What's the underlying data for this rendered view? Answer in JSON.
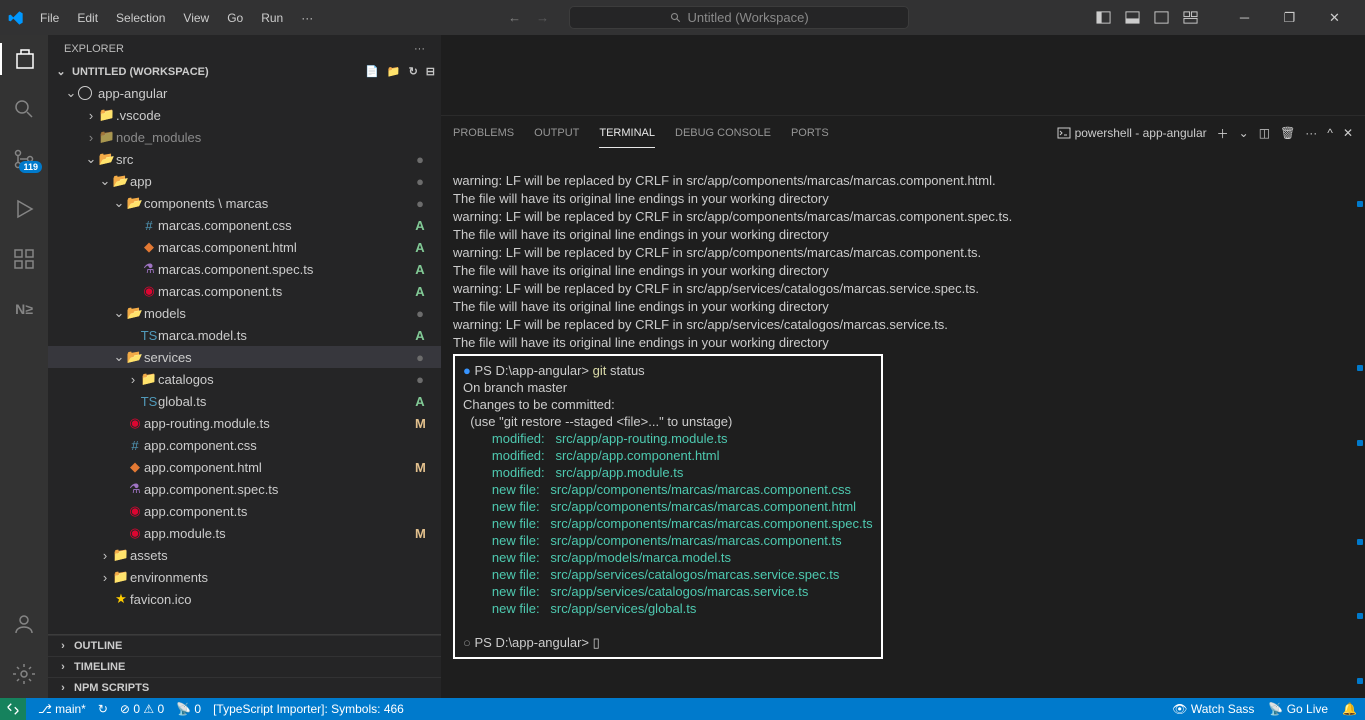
{
  "menu": [
    "File",
    "Edit",
    "Selection",
    "View",
    "Go",
    "Run"
  ],
  "searchBox": "Untitled (Workspace)",
  "scmBadge": "119",
  "explorer": {
    "title": "EXPLORER"
  },
  "workspace": "UNTITLED (WORKSPACE)",
  "rootFolder": "app-angular",
  "tree": {
    "vscode": ".vscode",
    "node_modules": "node_modules",
    "src": "src",
    "app": "app",
    "components": "components \\ marcas",
    "f_css": "marcas.component.css",
    "f_html": "marcas.component.html",
    "f_spec": "marcas.component.spec.ts",
    "f_ts": "marcas.component.ts",
    "models": "models",
    "model_ts": "marca.model.ts",
    "services": "services",
    "catalogos": "catalogos",
    "global": "global.ts",
    "routing": "app-routing.module.ts",
    "appcss": "app.component.css",
    "apphtml": "app.component.html",
    "appspec": "app.component.spec.ts",
    "appts": "app.component.ts",
    "appmodule": "app.module.ts",
    "assets": "assets",
    "env": "environments",
    "favicon": "favicon.ico"
  },
  "outline": "OUTLINE",
  "timeline": "TIMELINE",
  "npm": "NPM SCRIPTS",
  "panelTabs": {
    "problems": "PROBLEMS",
    "output": "OUTPUT",
    "terminal": "TERMINAL",
    "debug": "DEBUG CONSOLE",
    "ports": "PORTS"
  },
  "terminalSelector": "powershell - app-angular",
  "terminal": {
    "w1": "warning: LF will be replaced by CRLF in src/app/components/marcas/marcas.component.html.",
    "l1": "The file will have its original line endings in your working directory",
    "w2": "warning: LF will be replaced by CRLF in src/app/components/marcas/marcas.component.spec.ts.",
    "w3": "warning: LF will be replaced by CRLF in src/app/components/marcas/marcas.component.ts.",
    "w4": "warning: LF will be replaced by CRLF in src/app/services/catalogos/marcas.service.spec.ts.",
    "w5": "warning: LF will be replaced by CRLF in src/app/services/catalogos/marcas.service.ts.",
    "prompt1": "PS D:\\app-angular> ",
    "cmd1_a": "git ",
    "cmd1_b": "status",
    "branch": "On branch master",
    "changes": "Changes to be committed:",
    "hint": "  (use \"git restore --staged <file>...\" to unstage)",
    "m1": "        modified:   src/app/app-routing.module.ts",
    "m2": "        modified:   src/app/app.component.html",
    "m3": "        modified:   src/app/app.module.ts",
    "n1": "        new file:   src/app/components/marcas/marcas.component.css",
    "n2": "        new file:   src/app/components/marcas/marcas.component.html",
    "n3": "        new file:   src/app/components/marcas/marcas.component.spec.ts",
    "n4": "        new file:   src/app/components/marcas/marcas.component.ts",
    "n5": "        new file:   src/app/models/marca.model.ts",
    "n6": "        new file:   src/app/services/catalogos/marcas.service.spec.ts",
    "n7": "        new file:   src/app/services/catalogos/marcas.service.ts",
    "n8": "        new file:   src/app/services/global.ts",
    "prompt2": "PS D:\\app-angular> "
  },
  "status": {
    "branch": "main*",
    "sync": "↻",
    "errors": "0",
    "warnings": "0",
    "port": "0",
    "tsImporter": "[TypeScript Importer]: Symbols: 466",
    "watchSass": "Watch Sass",
    "goLive": "Go Live"
  }
}
